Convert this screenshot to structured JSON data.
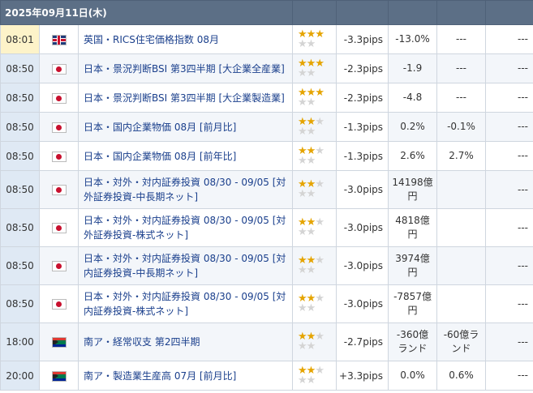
{
  "header": {
    "date": "2025年09月11日(木)"
  },
  "rows": [
    {
      "time": "08:01",
      "flag": "gb-flag-icon",
      "country": "gb",
      "name": "英国・RICS住宅価格指数 08月",
      "stars": 3,
      "pips": "-3.3pips",
      "actual": "-13.0%",
      "forecast": "---",
      "previous": "---"
    },
    {
      "time": "08:50",
      "flag": "jp-flag-icon",
      "country": "jp",
      "name": "日本・景況判断BSI 第3四半期 [大企業全産業]",
      "stars": 3,
      "pips": "-2.3pips",
      "actual": "-1.9",
      "forecast": "---",
      "previous": "---"
    },
    {
      "time": "08:50",
      "flag": "jp-flag-icon",
      "country": "jp",
      "name": "日本・景況判断BSI 第3四半期 [大企業製造業]",
      "stars": 3,
      "pips": "-2.3pips",
      "actual": "-4.8",
      "forecast": "---",
      "previous": "---"
    },
    {
      "time": "08:50",
      "flag": "jp-flag-icon",
      "country": "jp",
      "name": "日本・国内企業物価 08月 [前月比]",
      "stars": 2,
      "pips": "-1.3pips",
      "actual": "0.2%",
      "forecast": "-0.1%",
      "previous": "---"
    },
    {
      "time": "08:50",
      "flag": "jp-flag-icon",
      "country": "jp",
      "name": "日本・国内企業物価 08月 [前年比]",
      "stars": 2,
      "pips": "-1.3pips",
      "actual": "2.6%",
      "forecast": "2.7%",
      "previous": "---"
    },
    {
      "time": "08:50",
      "flag": "jp-flag-icon",
      "country": "jp",
      "name": "日本・対外・対内証券投資 08/30 - 09/05 [対外証券投資-中長期ネット]",
      "stars": 2,
      "pips": "-3.0pips",
      "actual": "14198億円",
      "forecast": "",
      "previous": "---"
    },
    {
      "time": "08:50",
      "flag": "jp-flag-icon",
      "country": "jp",
      "name": "日本・対外・対内証券投資 08/30 - 09/05 [対外証券投資-株式ネット]",
      "stars": 2,
      "pips": "-3.0pips",
      "actual": "4818億円",
      "forecast": "",
      "previous": "---"
    },
    {
      "time": "08:50",
      "flag": "jp-flag-icon",
      "country": "jp",
      "name": "日本・対外・対内証券投資 08/30 - 09/05 [対内証券投資-中長期ネット]",
      "stars": 2,
      "pips": "-3.0pips",
      "actual": "3974億円",
      "forecast": "",
      "previous": "---"
    },
    {
      "time": "08:50",
      "flag": "jp-flag-icon",
      "country": "jp",
      "name": "日本・対外・対内証券投資 08/30 - 09/05 [対内証券投資-株式ネット]",
      "stars": 2,
      "pips": "-3.0pips",
      "actual": "-7857億円",
      "forecast": "",
      "previous": "---"
    },
    {
      "time": "18:00",
      "flag": "za-flag-icon",
      "country": "za",
      "name": "南ア・経常収支 第2四半期",
      "stars": 2,
      "pips": "-2.7pips",
      "actual": "-360億ランド",
      "forecast": "-60億ランド",
      "previous": "---"
    },
    {
      "time": "20:00",
      "flag": "za-flag-icon",
      "country": "za",
      "name": "南ア・製造業生産高 07月 [前月比]",
      "stars": 2,
      "pips": "+3.3pips",
      "actual": "0.0%",
      "forecast": "0.6%",
      "previous": "---"
    }
  ]
}
